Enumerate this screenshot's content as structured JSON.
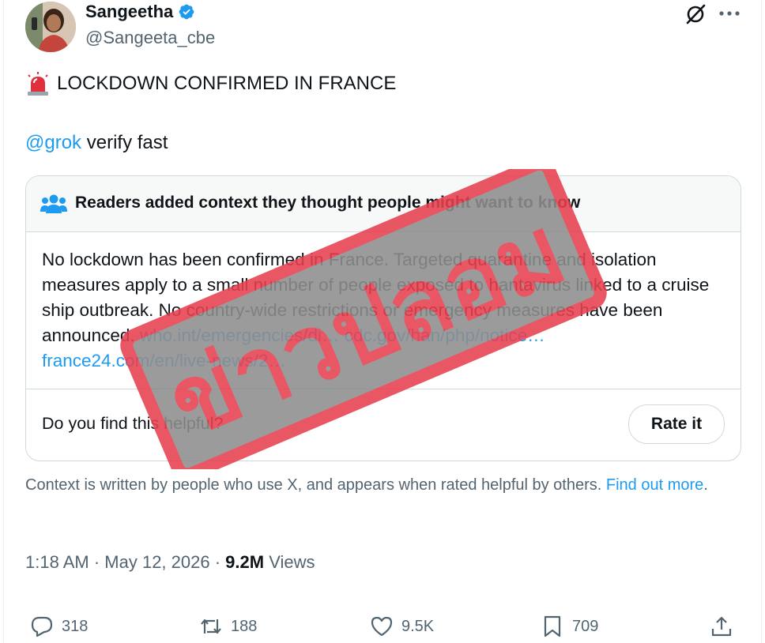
{
  "author": {
    "name": "Sangeetha",
    "handle": "@Sangeeta_cbe",
    "verified_color": "#1d9bf0"
  },
  "post": {
    "siren_icon": "police-light-icon",
    "headline": "LOCKDOWN CONFIRMED IN FRANCE",
    "mention": "@grok",
    "mention_rest": " verify fast"
  },
  "community_note": {
    "title": "Readers added context they thought people might want to know",
    "body": "No lockdown has been confirmed in France. Targeted quarantine and isolation measures apply to a small number of people exposed to hantavirus linked to a cruise ship outbreak. No country-wide restrictions or emergency measures have been announced. ",
    "links": [
      "who.int/emergencies/di…",
      "cdc.gov/han/php/notice…",
      "france24.com/en/live-news/2…"
    ],
    "question": "Do you find this helpful?",
    "rate_label": "Rate it"
  },
  "disclaimer": {
    "text": "Context is written by people who use X, and appears when rated helpful by others. ",
    "link": "Find out more",
    "end": "."
  },
  "meta": {
    "time": "1:18 AM",
    "date": "May 12, 2026",
    "views_count": "9.2M",
    "views_label": " Views",
    "separator": " · "
  },
  "actions": {
    "replies": "318",
    "reposts": "188",
    "likes": "9.5K",
    "bookmarks": "709"
  },
  "stamp": {
    "text": "ข่าวปลอม",
    "color": "#e8404f"
  },
  "colors": {
    "link": "#1d9bf0",
    "secondary_text": "#536471",
    "border": "#cfd9de"
  }
}
